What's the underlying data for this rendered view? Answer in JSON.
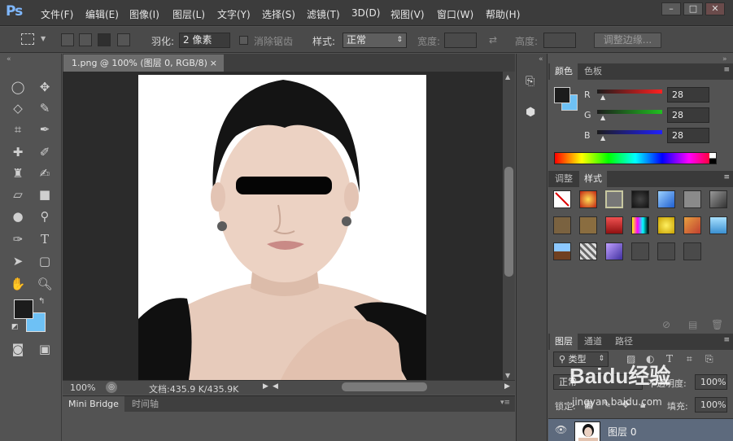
{
  "app": {
    "logo": "Ps"
  },
  "menu": [
    "文件(F)",
    "编辑(E)",
    "图像(I)",
    "图层(L)",
    "文字(Y)",
    "选择(S)",
    "滤镜(T)",
    "3D(D)",
    "视图(V)",
    "窗口(W)",
    "帮助(H)"
  ],
  "window_buttons": {
    "minimize": "–",
    "maximize": "□",
    "close": "✕"
  },
  "options": {
    "feather_label": "羽化:",
    "feather_value": "2 像素",
    "antialias_label": "消除锯齿",
    "style_label": "样式:",
    "style_value": "正常",
    "width_label": "宽度:",
    "height_label": "高度:",
    "refine_edge": "调整边缘..."
  },
  "document": {
    "tab_title": "1.png @ 100% (图层 0, RGB/8)",
    "tab_close": "×",
    "zoom": "100%",
    "doc_info": "文档:435.9 K/435.9K"
  },
  "bridge": {
    "tabs": [
      "Mini Bridge",
      "时间轴"
    ]
  },
  "color_panel": {
    "tabs": [
      "颜色",
      "色板"
    ],
    "channels": [
      {
        "label": "R",
        "value": "28"
      },
      {
        "label": "G",
        "value": "28"
      },
      {
        "label": "B",
        "value": "28"
      }
    ],
    "foreground": "#1c1c1c",
    "background": "#6ec1f5"
  },
  "styles_panel": {
    "tabs": [
      "调整",
      "样式"
    ]
  },
  "layers_panel": {
    "tabs": [
      "图层",
      "通道",
      "路径"
    ],
    "filter_kind": "类型",
    "blend_mode": "正常",
    "opacity_label": "不透明度:",
    "opacity_value": "100%",
    "lock_label": "锁定:",
    "fill_label": "填充:",
    "fill_value": "100%",
    "layers": [
      {
        "name": "图层 0"
      }
    ]
  },
  "watermark": {
    "text": "Baidu经验",
    "url": "jingyan.baidu.com"
  }
}
